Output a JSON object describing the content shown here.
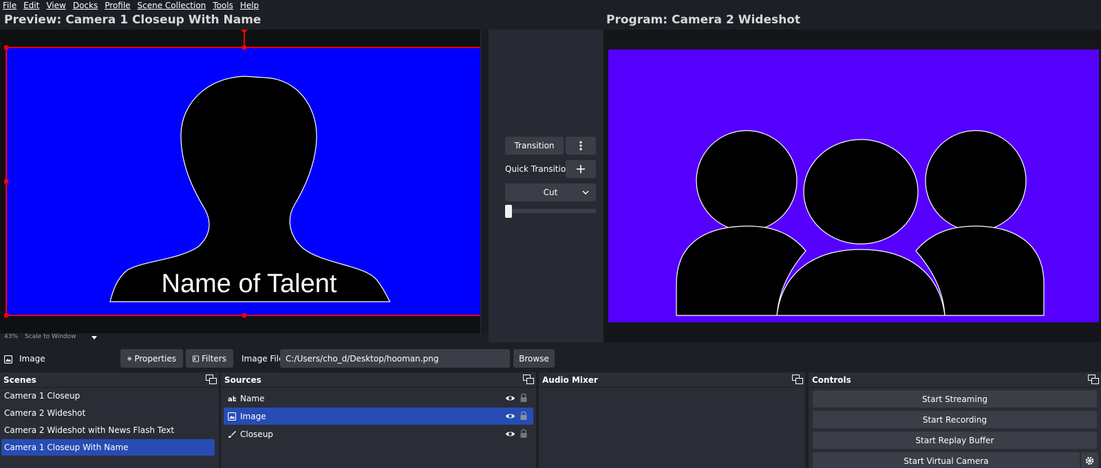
{
  "menu": {
    "file": "File",
    "edit": "Edit",
    "view": "View",
    "docks": "Docks",
    "profile": "Profile",
    "scene_collection": "Scene Collection",
    "tools": "Tools",
    "help": "Help"
  },
  "preview": {
    "title": "Preview: Camera 1 Closeup  With Name",
    "overlay_text": "Name of Talent",
    "canvas_color": "#0000ff"
  },
  "program": {
    "title": "Program: Camera 2 Wideshot",
    "canvas_color": "#5500ff"
  },
  "transitions": {
    "transition_label": "Transition",
    "quick_transitions_label": "Quick Transitions",
    "selected": "Cut"
  },
  "zoom": {
    "percent": "43%",
    "mode": "Scale to Window"
  },
  "source_properties": {
    "source_name": "Image",
    "properties_label": "Properties",
    "filters_label": "Filters",
    "image_file_label": "Image File",
    "image_file_path": "C:/Users/cho_d/Desktop/hooman.png",
    "browse_label": "Browse"
  },
  "scenes": {
    "title": "Scenes",
    "items": [
      "Camera 1 Closeup",
      "Camera 2 Wideshot",
      "Camera 2 Wideshot with News Flash Text",
      "Camera 1 Closeup  With Name"
    ],
    "selected_index": 3
  },
  "sources": {
    "title": "Sources",
    "items": [
      {
        "label": "Name",
        "icon": "text-icon"
      },
      {
        "label": "Image",
        "icon": "image-icon"
      },
      {
        "label": "Closeup",
        "icon": "brush-icon"
      }
    ],
    "selected_index": 1
  },
  "audio_mixer": {
    "title": "Audio Mixer"
  },
  "controls": {
    "title": "Controls",
    "start_streaming": "Start Streaming",
    "start_recording": "Start Recording",
    "start_replay_buffer": "Start Replay Buffer",
    "start_virtual_camera": "Start Virtual Camera"
  },
  "colors": {
    "selection": "#274cb3",
    "preview_border": "#ff0000",
    "panel_bg": "#2a2d35"
  }
}
